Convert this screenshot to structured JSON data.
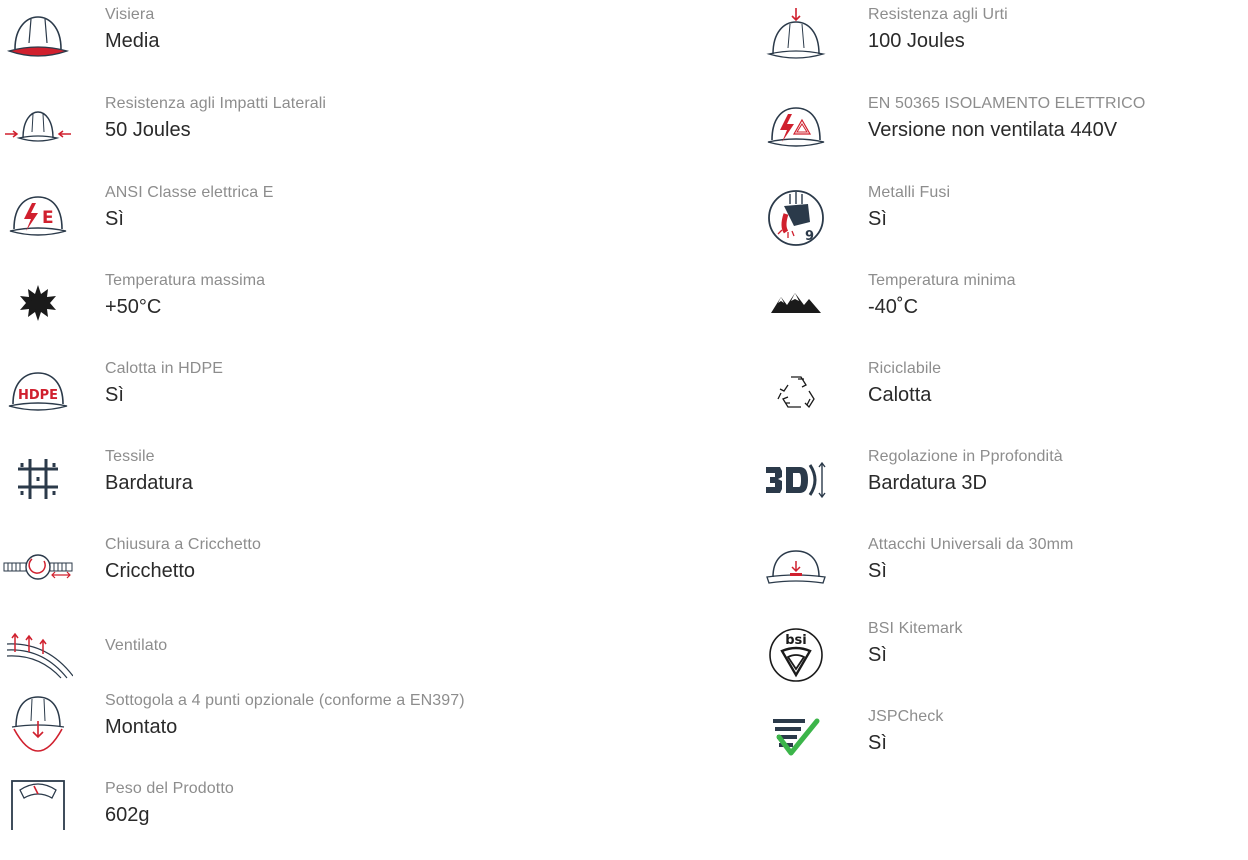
{
  "colors": {
    "accent": "#d0202e",
    "outline": "#2b3a4a",
    "check": "#3cb54a",
    "label": "#8d8d8d",
    "value": "#2a2a2a"
  },
  "features_left": [
    {
      "icon": "helmet-visor-icon",
      "label": "Visiera",
      "value": "Media"
    },
    {
      "icon": "side-impact-icon",
      "label": "Resistenza agli Impatti Laterali",
      "value": "50 Joules"
    },
    {
      "icon": "electrical-class-e-icon",
      "label": "ANSI Classe elettrica E",
      "value": "Sì"
    },
    {
      "icon": "sun-icon",
      "label": "Temperatura massima",
      "value": "+50°C"
    },
    {
      "icon": "hdpe-helmet-icon",
      "label": "Calotta in HDPE",
      "value": "Sì"
    },
    {
      "icon": "textile-grid-icon",
      "label": "Tessile",
      "value": "Bardatura"
    },
    {
      "icon": "ratchet-icon",
      "label": "Chiusura a Cricchetto",
      "value": "Cricchetto"
    },
    {
      "icon": "ventilation-icon",
      "label": "Ventilato",
      "value": ""
    },
    {
      "icon": "chinstrap-icon",
      "label": "Sottogola a 4 punti opzionale (conforme a EN397)",
      "value": "Montato"
    },
    {
      "icon": "scale-icon",
      "label": "Peso del Prodotto",
      "value": "602g"
    }
  ],
  "features_right": [
    {
      "icon": "top-impact-icon",
      "label": "Resistenza agli Urti",
      "value": "100 Joules"
    },
    {
      "icon": "electrical-insulation-icon",
      "label": "EN 50365 ISOLAMENTO ELETTRICO",
      "value": "Versione non ventilata 440V"
    },
    {
      "icon": "molten-metal-icon",
      "label": "Metalli Fusi",
      "value": "Sì"
    },
    {
      "icon": "mountains-icon",
      "label": "Temperatura minima",
      "value": "-40˚C"
    },
    {
      "icon": "recycle-icon",
      "label": "Riciclabile",
      "value": "Calotta"
    },
    {
      "icon": "3d-adjust-icon",
      "label": "Regolazione in Pprofondità",
      "value": "Bardatura 3D"
    },
    {
      "icon": "universal-slots-icon",
      "label": "Attacchi Universali da 30mm",
      "value": "Sì"
    },
    {
      "icon": "bsi-kitemark-icon",
      "label": "BSI Kitemark",
      "value": "Sì"
    },
    {
      "icon": "jspcheck-icon",
      "label": "JSPCheck",
      "value": "Sì"
    }
  ],
  "bsi_logo_text": "bsi",
  "hdpe_logo_text": "HDPE",
  "molten_metal_level": "9"
}
